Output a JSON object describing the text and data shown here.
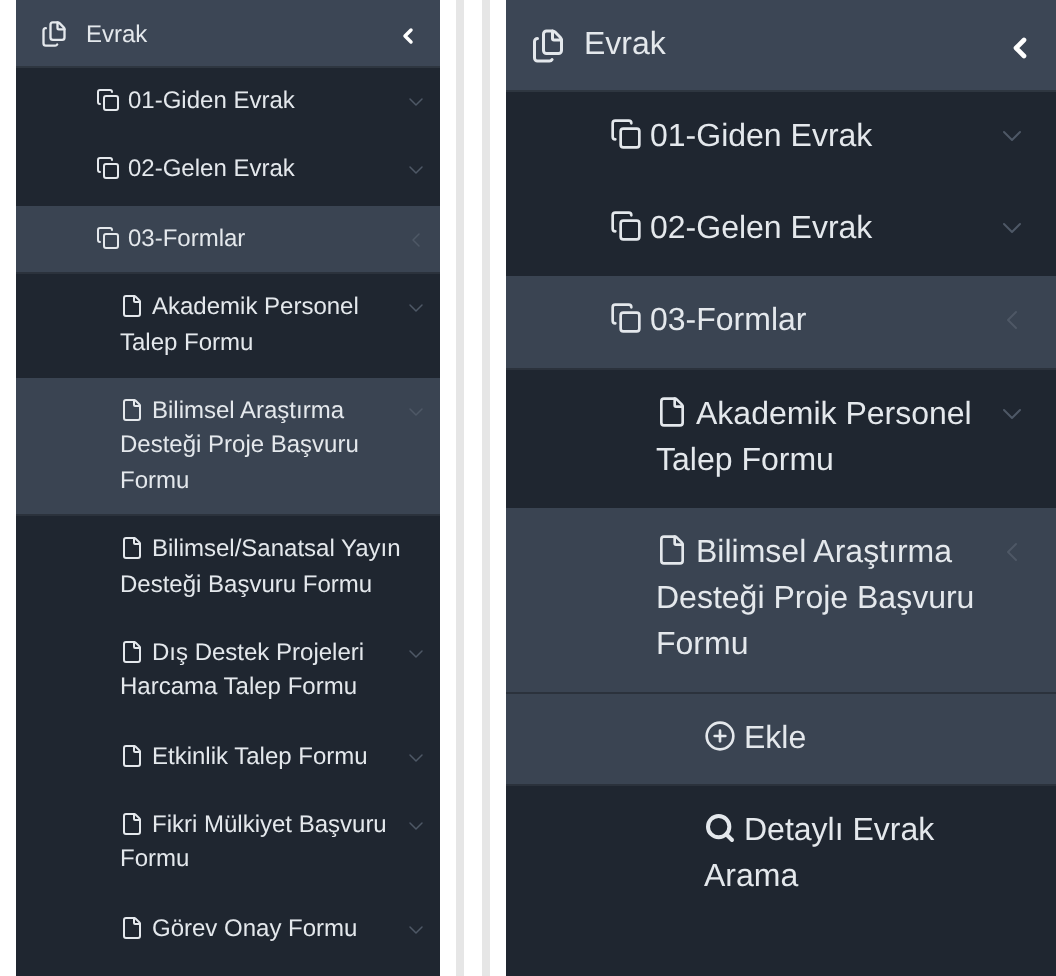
{
  "panels": [
    {
      "header": {
        "label": "Evrak",
        "expanded": true
      },
      "items": [
        {
          "label": "01-Giden Evrak",
          "expanded": false,
          "selected": false
        },
        {
          "label": "02-Gelen Evrak",
          "expanded": false,
          "selected": false
        },
        {
          "label": "03-Formlar",
          "expanded": true,
          "selected": true,
          "children": [
            {
              "label": "Akademik Personel Talep Formu",
              "expanded": false,
              "selected": false
            },
            {
              "label": "Bilimsel Araştırma Desteği Proje Başvuru Formu",
              "expanded": false,
              "selected": true
            },
            {
              "label": "Bilimsel/Sanatsal Yayın Desteği Başvuru Formu",
              "selected": false
            },
            {
              "label": "Dış Destek Projeleri Harcama Talep Formu",
              "expanded": false,
              "selected": false
            },
            {
              "label": "Etkinlik Talep Formu",
              "expanded": false,
              "selected": false
            },
            {
              "label": "Fikri Mülkiyet Başvuru Formu",
              "expanded": false,
              "selected": false
            },
            {
              "label": "Görev Onay Formu",
              "expanded": false,
              "selected": false
            }
          ]
        }
      ]
    },
    {
      "header": {
        "label": "Evrak",
        "expanded": true
      },
      "items": [
        {
          "label": "01-Giden Evrak",
          "expanded": false,
          "selected": false
        },
        {
          "label": "02-Gelen Evrak",
          "expanded": false,
          "selected": false
        },
        {
          "label": "03-Formlar",
          "expanded": true,
          "selected": true,
          "children": [
            {
              "label": "Akademik Personel Talep Formu",
              "expanded": false,
              "selected": false
            },
            {
              "label": "Bilimsel Araştırma Desteği Proje Başvuru Formu",
              "expanded": true,
              "selected": true,
              "children": [
                {
                  "label": "Ekle",
                  "selected": true
                },
                {
                  "label": "Detaylı Evrak Arama",
                  "selected": false
                }
              ]
            }
          ]
        }
      ]
    }
  ]
}
